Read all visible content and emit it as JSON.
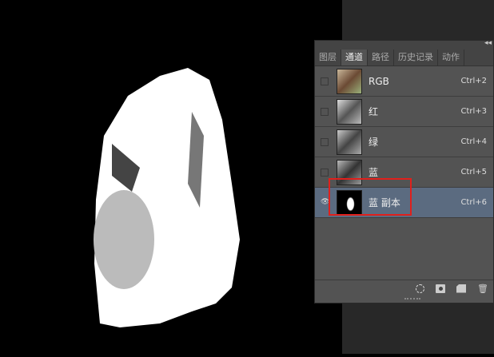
{
  "tabs": [
    "图层",
    "通道",
    "路径",
    "历史记录",
    "动作"
  ],
  "active_tab": "通道",
  "channels": [
    {
      "name": "RGB",
      "shortcut": "Ctrl+2",
      "visible": false,
      "selected": false
    },
    {
      "name": "红",
      "shortcut": "Ctrl+3",
      "visible": false,
      "selected": false
    },
    {
      "name": "绿",
      "shortcut": "Ctrl+4",
      "visible": false,
      "selected": false
    },
    {
      "name": "蓝",
      "shortcut": "Ctrl+5",
      "visible": false,
      "selected": false
    },
    {
      "name": "蓝 副本",
      "shortcut": "Ctrl+6",
      "visible": true,
      "selected": true
    }
  ],
  "footer_icons": [
    "load-selection-icon",
    "save-selection-icon",
    "new-channel-icon",
    "trash-icon"
  ],
  "highlight_color": "#e0201c"
}
